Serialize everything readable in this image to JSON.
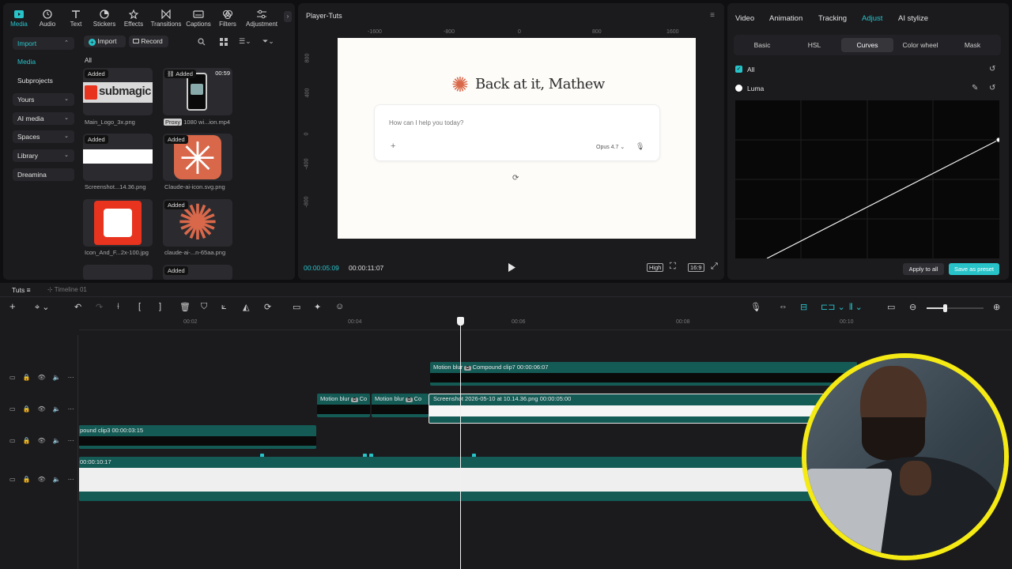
{
  "toolbar": {
    "items": [
      {
        "label": "Media",
        "icon": "media-icon"
      },
      {
        "label": "Audio",
        "icon": "audio-icon"
      },
      {
        "label": "Text",
        "icon": "text-icon"
      },
      {
        "label": "Stickers",
        "icon": "stickers-icon"
      },
      {
        "label": "Effects",
        "icon": "effects-icon"
      },
      {
        "label": "Transitions",
        "icon": "transitions-icon"
      },
      {
        "label": "Captions",
        "icon": "captions-icon"
      },
      {
        "label": "Filters",
        "icon": "filters-icon"
      },
      {
        "label": "Adjustment",
        "icon": "adjustment-icon"
      }
    ]
  },
  "sidebar": {
    "items": [
      {
        "label": "Import"
      },
      {
        "label": "Media"
      },
      {
        "label": "Subprojects"
      },
      {
        "label": "Yours"
      },
      {
        "label": "AI media"
      },
      {
        "label": "Spaces"
      },
      {
        "label": "Library"
      },
      {
        "label": "Dreamina"
      }
    ]
  },
  "media": {
    "import_label": "Import",
    "record_label": "Record",
    "filter_all": "All",
    "added_badge": "Added",
    "proxy_badge": "Proxy",
    "items": [
      {
        "name": "Main_Logo_3x.png"
      },
      {
        "name": "1080 wi...ion.mp4",
        "duration": "00:59"
      },
      {
        "name": "Screenshot...14.36.png"
      },
      {
        "name": "Claude-ai-icon.svg.png"
      },
      {
        "name": "Icon_And_F...2x-100.jpg"
      },
      {
        "name": "claude-ai-...n-65aa.png"
      }
    ],
    "logo_text": "submagic"
  },
  "player": {
    "title": "Player-Tuts",
    "ruler": [
      "-1600",
      "-800",
      "0",
      "800",
      "1600"
    ],
    "vruler": [
      "800",
      "400",
      "0",
      "-400",
      "-800"
    ],
    "greeting": "Back at it, Mathew",
    "prompt_placeholder": "How can I help you today?",
    "model": "Opus 4.7",
    "current_time": "00:00:05:09",
    "total_time": "00:00:11:07",
    "quality": "High",
    "ratio": "16:9"
  },
  "inspector": {
    "tabs": [
      "Video",
      "Animation",
      "Tracking",
      "Adjust",
      "AI stylize"
    ],
    "subtabs": [
      "Basic",
      "HSL",
      "Curves",
      "Color wheel",
      "Mask"
    ],
    "channels": [
      "All",
      "Luma"
    ],
    "apply_all": "Apply to all",
    "save_preset": "Save as preset"
  },
  "timeline": {
    "project": "Tuts",
    "timeline_name": "Timeline 01",
    "ruler": [
      "00:02",
      "00:04",
      "00:06",
      "00:08",
      "00:10"
    ],
    "clips": {
      "motion_blur": "Motion blur",
      "compound7": "Compound clip7",
      "compound7_dur": "00:00:06:07",
      "mb2": "Motion blur",
      "mb3": "Motion blur",
      "c_short": "Co",
      "screenshot": "Screenshot 2026-05-10 at 10.14.36.png",
      "screenshot_dur": "00:00:05:00",
      "compound3": "pound clip3",
      "compound3_dur": "00:00:03:15",
      "main_dur": "00:00:10:17"
    }
  },
  "colors": {
    "accent": "#27c3c9",
    "clip_teal": "#145a55",
    "webcam_ring": "#f5ea14",
    "claude_orange": "#d9684a"
  }
}
